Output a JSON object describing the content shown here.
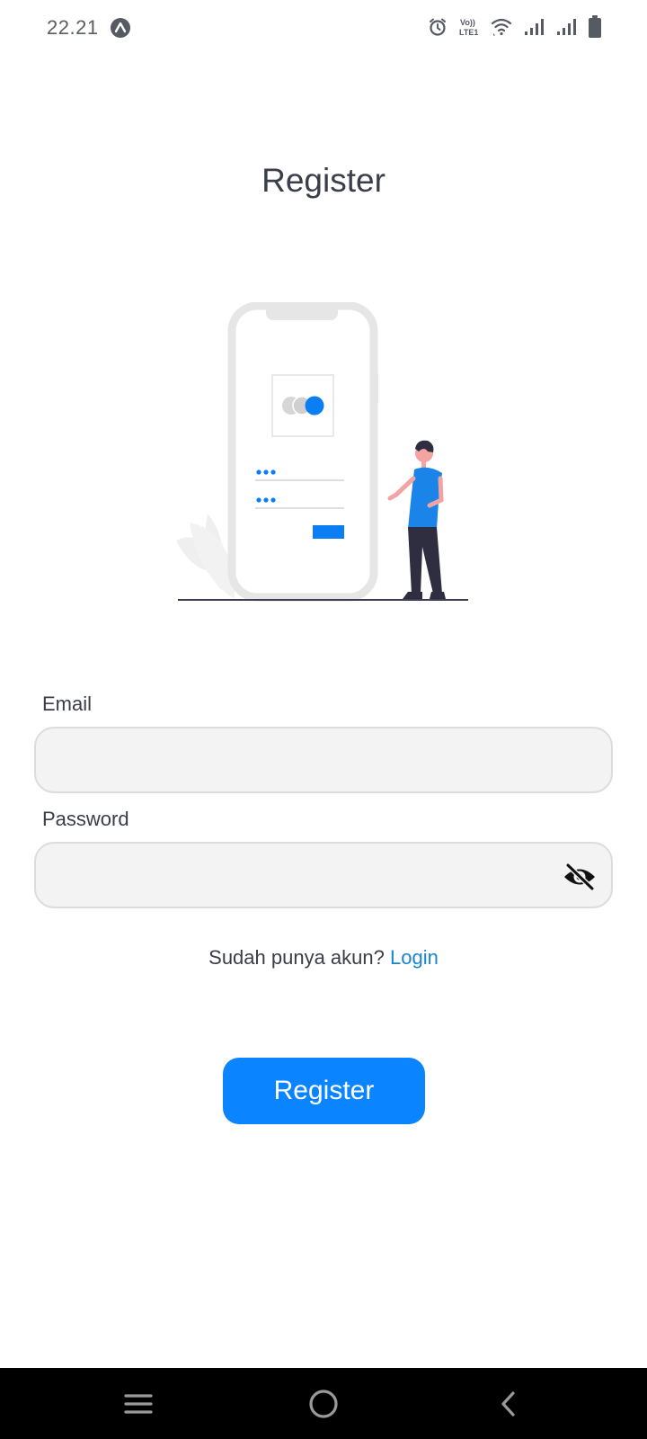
{
  "status_bar": {
    "time": "22.21",
    "icons": [
      "app-notification-icon",
      "alarm-icon",
      "volte-icon",
      "wifi-icon",
      "signal-sim1-icon",
      "signal-sim2-icon",
      "battery-icon"
    ],
    "volte_top": "Vo))",
    "volte_bottom": "LTE1"
  },
  "page": {
    "title": "Register"
  },
  "form": {
    "email_label": "Email",
    "email_value": "",
    "password_label": "Password",
    "password_value": "",
    "password_toggle_icon": "eye-off-icon"
  },
  "login_prompt": {
    "text": "Sudah punya akun?",
    "link": "Login"
  },
  "actions": {
    "register_label": "Register"
  },
  "nav_bar": {
    "icons": [
      "recent-apps-icon",
      "home-icon",
      "back-icon"
    ]
  },
  "colors": {
    "accent": "#0a84ff",
    "link": "#1a84d0",
    "field_bg": "#f3f3f3",
    "text": "#3a3d47"
  }
}
